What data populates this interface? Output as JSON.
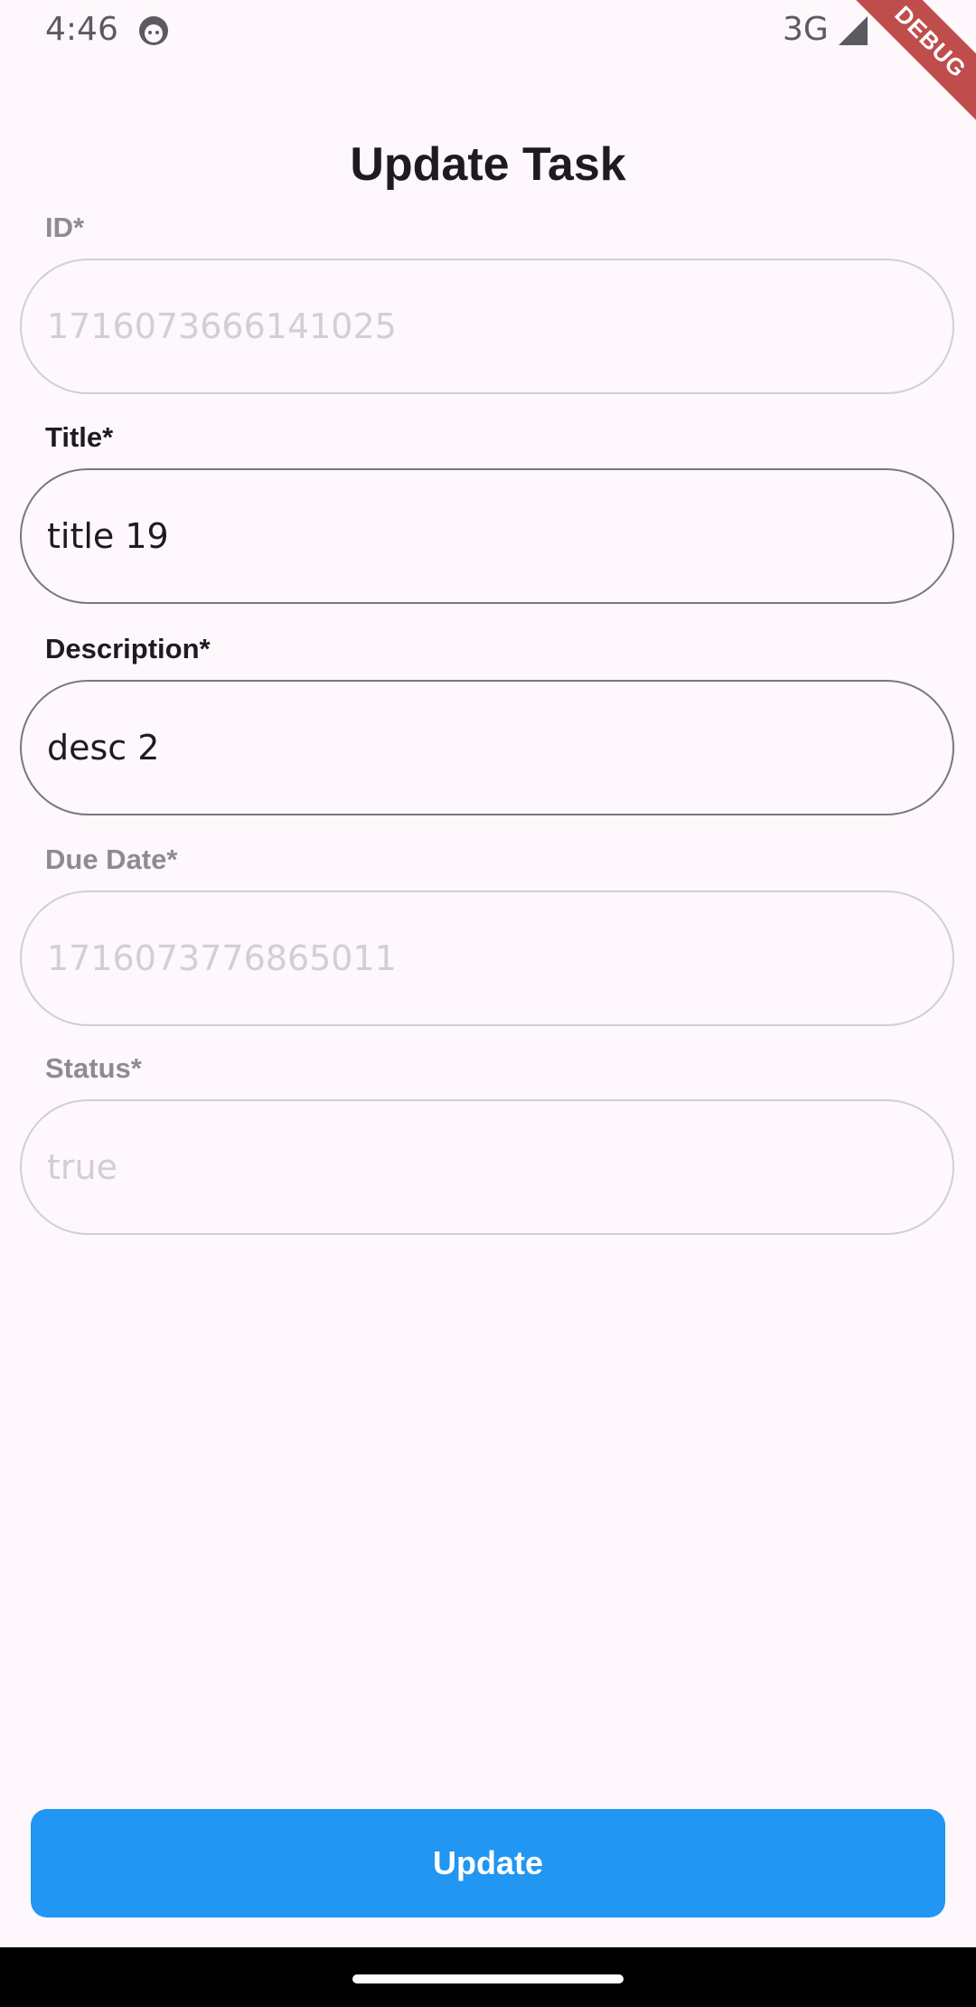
{
  "status_bar": {
    "time": "4:46",
    "network": "3G",
    "face_icon": "android-face-icon",
    "signal_icon": "signal-triangle-icon"
  },
  "debug_banner": {
    "label": "DEBUG",
    "color": "#b5302e"
  },
  "page": {
    "title": "Update Task"
  },
  "form": {
    "id": {
      "label": "ID*",
      "value": "1716073666141025",
      "enabled": false
    },
    "title": {
      "label": "Title*",
      "value": "title 19",
      "enabled": true
    },
    "description": {
      "label": "Description*",
      "value": "desc 2",
      "enabled": true
    },
    "due_date": {
      "label": "Due Date*",
      "value": "1716073776865011",
      "enabled": false
    },
    "status": {
      "label": "Status*",
      "value": "true",
      "enabled": false
    }
  },
  "actions": {
    "update_label": "Update",
    "update_color": "#2196f3"
  },
  "colors": {
    "background": "#fef7fb",
    "disabled_border": "#d3ced3",
    "enabled_border": "#7a777c",
    "text_primary": "#1d1b20"
  }
}
